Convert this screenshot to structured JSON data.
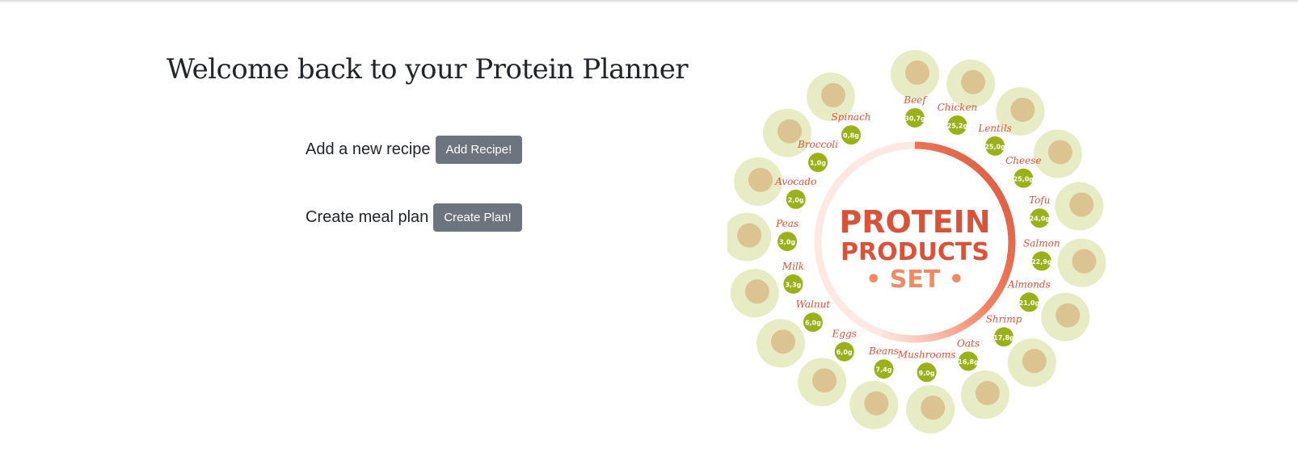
{
  "page": {
    "title": "Welcome back to your Protein Planner"
  },
  "actions": {
    "recipe": {
      "label": "Add a new recipe",
      "button": "Add Recipe!"
    },
    "plan": {
      "label": "Create meal plan",
      "button": "Create Plan!"
    }
  },
  "infographic": {
    "title_line1": "PROTEIN",
    "title_line2": "PRODUCTS",
    "title_line3": "• SET •",
    "items": [
      {
        "name": "Beef",
        "amount": "30,7g"
      },
      {
        "name": "Chicken",
        "amount": "25,2g"
      },
      {
        "name": "Lentils",
        "amount": "25,0g"
      },
      {
        "name": "Cheese",
        "amount": "25,0g"
      },
      {
        "name": "Tofu",
        "amount": "24,0g"
      },
      {
        "name": "Salmon",
        "amount": "22,9g"
      },
      {
        "name": "Almonds",
        "amount": "21,0g"
      },
      {
        "name": "Shrimp",
        "amount": "17,8g"
      },
      {
        "name": "Oats",
        "amount": "16,8g"
      },
      {
        "name": "Mushrooms",
        "amount": "9,0g"
      },
      {
        "name": "Beans",
        "amount": "7,4g"
      },
      {
        "name": "Eggs",
        "amount": "6,0g"
      },
      {
        "name": "Walnut",
        "amount": "6,0g"
      },
      {
        "name": "Milk",
        "amount": "3,3g"
      },
      {
        "name": "Peas",
        "amount": "3,0g"
      },
      {
        "name": "Avocado",
        "amount": "2,0g"
      },
      {
        "name": "Broccoli",
        "amount": "1,0g"
      },
      {
        "name": "Spinach",
        "amount": "0,8g"
      }
    ],
    "colors": {
      "accent": "#d9533a",
      "badge": "#9bb11a",
      "blob": "#e7ecc4",
      "ring_light": "#fbe1d8"
    }
  }
}
